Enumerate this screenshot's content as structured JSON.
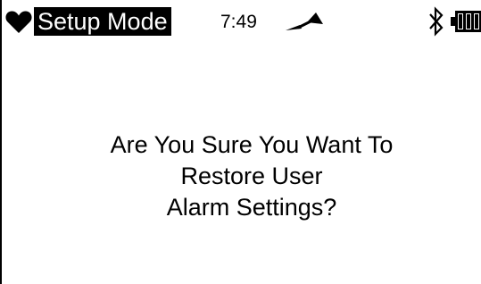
{
  "status_bar": {
    "mode_label": "Setup Mode",
    "time": "7:49",
    "icons": {
      "status": "heart-icon",
      "signal": "signal-icon",
      "connectivity": "bluetooth-icon",
      "battery": "battery-icon"
    },
    "battery_level": 1.0
  },
  "dialog": {
    "lines": [
      "Are You Sure You Want To",
      "Restore User",
      "Alarm Settings?"
    ]
  },
  "colors": {
    "background": "#ffffff",
    "foreground": "#000000",
    "highlight_background": "#000000",
    "highlight_text": "#ffffff"
  }
}
